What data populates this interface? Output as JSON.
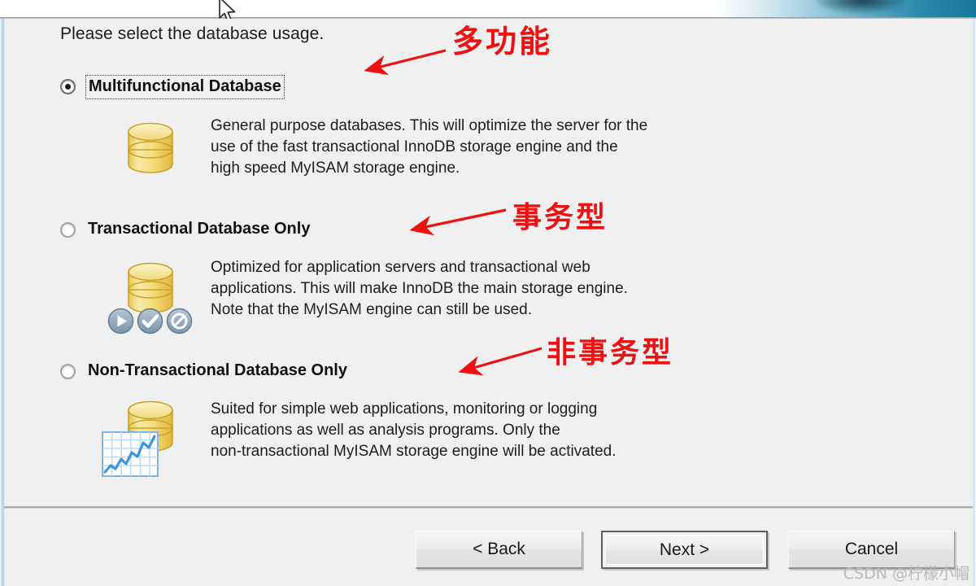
{
  "window": {
    "prompt": "Please select the database usage.",
    "cursor_icon": "mouse-pointer-icon"
  },
  "options": [
    {
      "id": "multifunctional",
      "label": "Multifunctional Database",
      "selected": true,
      "focused": true,
      "icon": "database-cylinder-icon",
      "description": "General purpose databases. This will optimize the server for the\nuse of the fast transactional InnoDB storage engine and the\nhigh speed MyISAM storage engine."
    },
    {
      "id": "transactional",
      "label": "Transactional Database Only",
      "selected": false,
      "focused": false,
      "icon": "database-cylinder-with-status-badges-icon",
      "badges": [
        "play-badge-icon",
        "check-badge-icon",
        "blocked-badge-icon"
      ],
      "description": "Optimized for application servers and transactional web\napplications. This will make InnoDB the main storage engine.\nNote that the MyISAM engine can still be used."
    },
    {
      "id": "non-transactional",
      "label": "Non-Transactional Database Only",
      "selected": false,
      "focused": false,
      "icon": "database-cylinder-with-chart-icon",
      "description": "Suited for simple web applications, monitoring or logging\napplications as well as analysis programs. Only the\nnon-transactional MyISAM storage engine will be activated."
    }
  ],
  "annotations": [
    {
      "text": "多功能",
      "color": "#ee1111",
      "points_to": "multifunctional"
    },
    {
      "text": "事务型",
      "color": "#ee1111",
      "points_to": "transactional"
    },
    {
      "text": "非事务型",
      "color": "#ee1111",
      "points_to": "non-transactional"
    }
  ],
  "footer": {
    "back_label": "< Back",
    "next_label": "Next >",
    "cancel_label": "Cancel",
    "default_button": "next"
  },
  "watermark": {
    "text": "CSDN @柠檬小帽",
    "color": "#b9b9b9"
  },
  "colors": {
    "dialog_bg": "#f0f0f0",
    "annotation_red": "#ee1111",
    "titlebar_teal": "#16789b",
    "icon_gold": "#f2d96a",
    "badge_blue": "#8fa8bd"
  }
}
